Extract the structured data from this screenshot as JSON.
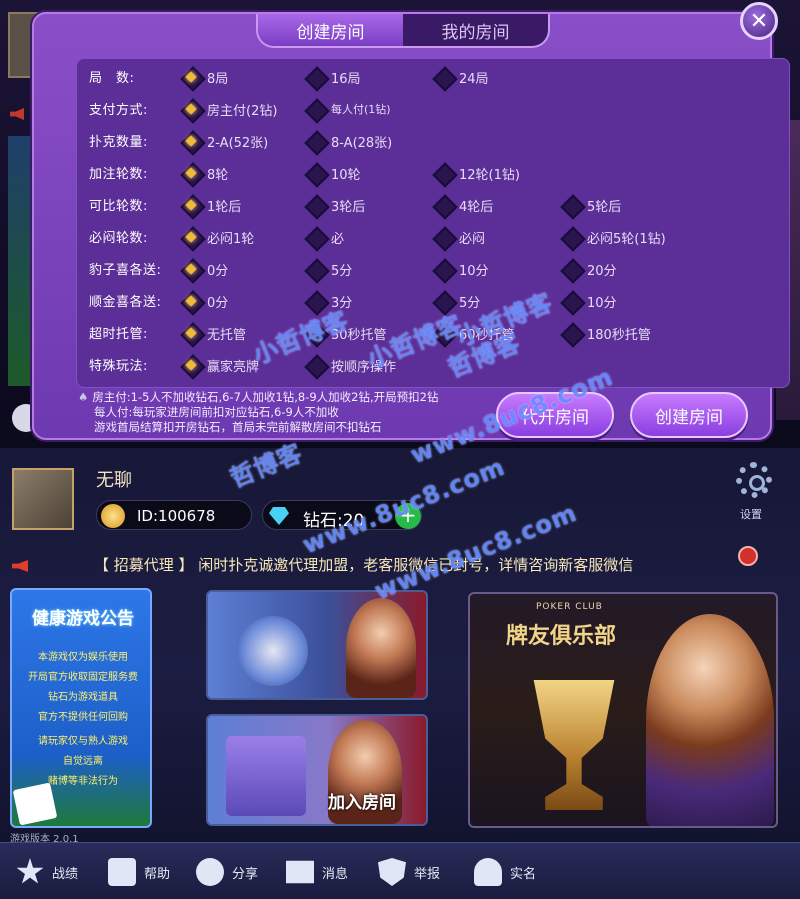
{
  "dialog": {
    "tabs": [
      {
        "label": "创建房间",
        "active": true
      },
      {
        "label": "我的房间",
        "active": false
      }
    ],
    "close_glyph": "✕",
    "rows": [
      {
        "label": "局　数:",
        "options": [
          {
            "text": "8局",
            "selected": true
          },
          {
            "text": "16局",
            "selected": false
          },
          {
            "text": "24局",
            "selected": false
          }
        ]
      },
      {
        "label": "支付方式:",
        "options": [
          {
            "text": "房主付(2钻)",
            "selected": true
          },
          {
            "text": "每人付(1钻)",
            "selected": false
          }
        ]
      },
      {
        "label": "扑克数量:",
        "options": [
          {
            "text": "2-A(52张)",
            "selected": true
          },
          {
            "text": "8-A(28张)",
            "selected": false
          }
        ]
      },
      {
        "label": "加注轮数:",
        "options": [
          {
            "text": "8轮",
            "selected": true
          },
          {
            "text": "10轮",
            "selected": false
          },
          {
            "text": "12轮(1钻)",
            "selected": false
          }
        ]
      },
      {
        "label": "可比轮数:",
        "options": [
          {
            "text": "1轮后",
            "selected": true
          },
          {
            "text": "3轮后",
            "selected": false
          },
          {
            "text": "4轮后",
            "selected": false
          },
          {
            "text": "5轮后",
            "selected": false
          }
        ]
      },
      {
        "label": "必闷轮数:",
        "options": [
          {
            "text": "必闷1轮",
            "selected": true
          },
          {
            "text": "必",
            "selected": false
          },
          {
            "text": "必闷",
            "selected": false
          },
          {
            "text": "必闷5轮(1钻)",
            "selected": false
          }
        ]
      },
      {
        "label": "豹子喜各送:",
        "options": [
          {
            "text": "0分",
            "selected": true
          },
          {
            "text": "5分",
            "selected": false
          },
          {
            "text": "10分",
            "selected": false
          },
          {
            "text": "20分",
            "selected": false
          }
        ]
      },
      {
        "label": "顺金喜各送:",
        "options": [
          {
            "text": "0分",
            "selected": true
          },
          {
            "text": "3分",
            "selected": false
          },
          {
            "text": "5分",
            "selected": false
          },
          {
            "text": "10分",
            "selected": false
          }
        ]
      },
      {
        "label": "超时托管:",
        "options": [
          {
            "text": "无托管",
            "selected": true
          },
          {
            "text": "30秒托管",
            "selected": false
          },
          {
            "text": "60秒托管",
            "selected": false
          },
          {
            "text": "180秒托管",
            "selected": false
          }
        ]
      },
      {
        "label": "特殊玩法:",
        "options": [
          {
            "text": "赢家亮牌",
            "selected": true
          },
          {
            "text": "按顺序操作",
            "selected": false
          }
        ]
      }
    ],
    "note_lines": [
      "房主付:1-5人不加收钻石,6-7人加收1钻,8-9人加收2钻,开局预扣2钻",
      "每人付:每玩家进房间前扣对应钻石,6-9人不加收",
      "游戏首局结算扣开房钻石，首局未完前解散房间不扣钻石"
    ],
    "proxy_open_label": "代开房间",
    "create_label": "创建房间"
  },
  "watermarks": [
    "小哲博客",
    "小哲博客",
    "哲博客",
    "小哲博客",
    "www.8uc8.com",
    "哲博客",
    "www.8uc8.com",
    "www.8uc8.com"
  ],
  "lobby": {
    "nickname": "无聊",
    "id_text": "ID:100678",
    "diamond_text": "钻石:20",
    "plus_glyph": "+",
    "settings_label": "设置",
    "marquee_text": "【 招募代理 】 闲时扑克诚邀代理加盟，老客服微信已封号，详情咨询新客服微信",
    "notice": {
      "title": "健康游戏公告",
      "lines": [
        "本游戏仅为娱乐使用",
        "开局官方收取固定服务费",
        "钻石为游戏道具",
        "官方不提供任何回购",
        "请玩家仅与熟人游戏",
        "自觉远离",
        "赌博等非法行为"
      ]
    },
    "version_text": "游戏版本 2.0.1",
    "join_label": "加入房间",
    "club_small": "POKER CLUB",
    "club_title": "牌友俱乐部",
    "nav": [
      {
        "label": "战绩",
        "icon": "star-icon"
      },
      {
        "label": "帮助",
        "icon": "help-icon"
      },
      {
        "label": "分享",
        "icon": "share-icon"
      },
      {
        "label": "消息",
        "icon": "mail-icon"
      },
      {
        "label": "举报",
        "icon": "shield-icon"
      },
      {
        "label": "实名",
        "icon": "user-icon"
      }
    ]
  },
  "colors": {
    "dialog_purple": "#7a43bc",
    "selected_gold": "#f3b93a",
    "watermark_blue": "#5a82ff",
    "accent_green": "#29b84a"
  }
}
